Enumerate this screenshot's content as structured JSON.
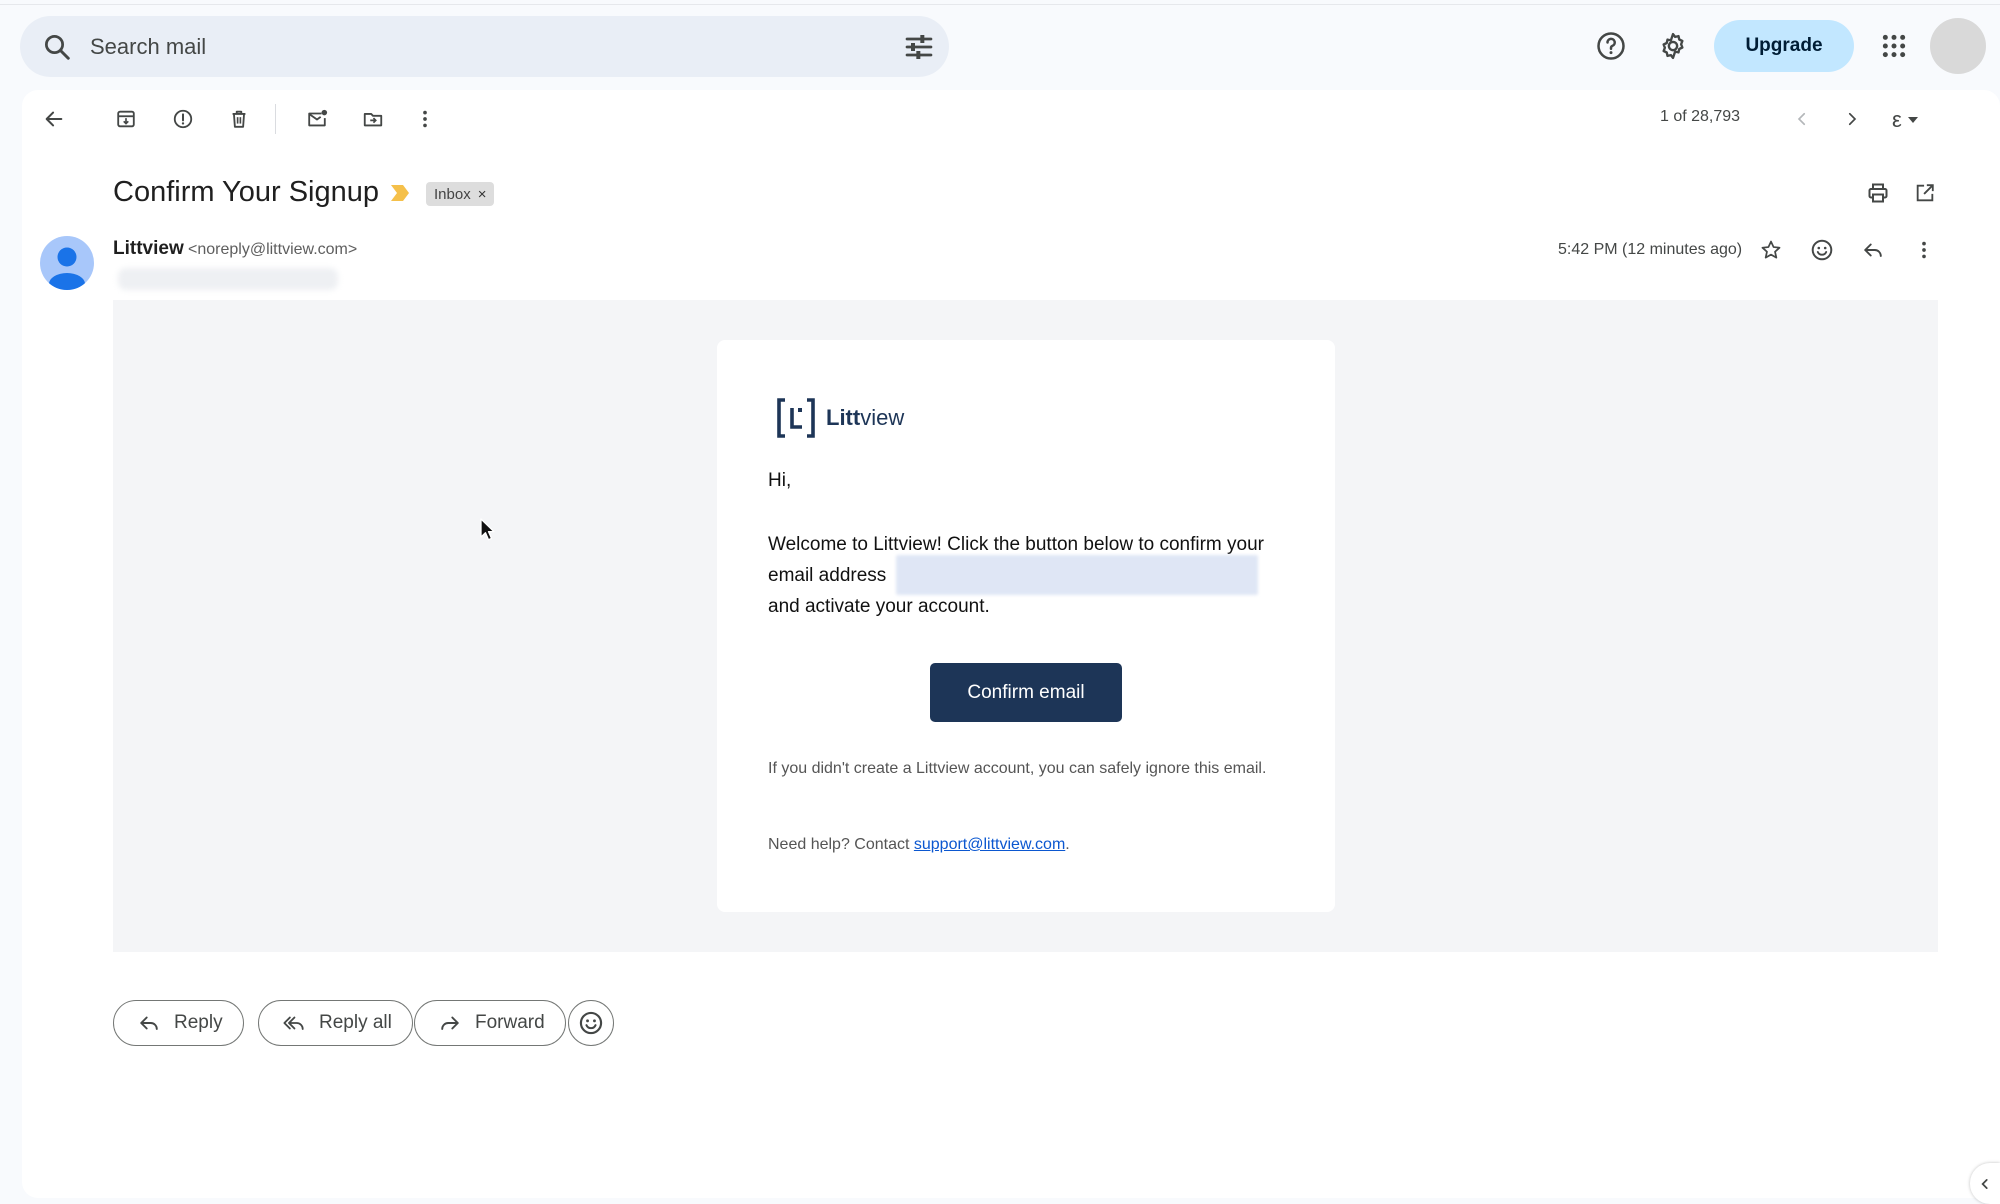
{
  "search": {
    "placeholder": "Search mail"
  },
  "header": {
    "upgrade_label": "Upgrade"
  },
  "toolbar": {
    "pager_text": "1 of 28,793",
    "lang_glyph": "ε"
  },
  "message": {
    "subject": "Confirm Your Signup",
    "label": "Inbox",
    "label_remove": "×",
    "sender_name": "Littview",
    "sender_email": "<noreply@littview.com>",
    "timestamp": "5:42 PM (12 minutes ago)"
  },
  "email_body": {
    "brand_bold": "Litt",
    "brand_rest": "view",
    "greeting": "Hi,",
    "welcome_text": "Welcome to Littview! Click the button below to confirm your email address",
    "welcome_text_end": "and activate your account.",
    "confirm_label": "Confirm email",
    "ignore_text": "If you didn't create a Littview account, you can safely ignore this email.",
    "help_prefix": "Need help? Contact ",
    "help_link": "support@littview.com",
    "help_suffix": ".",
    "brand_color": "#1d3557"
  },
  "actions": {
    "reply_label": "Reply",
    "reply_all_label": "Reply all",
    "forward_label": "Forward"
  },
  "colors": {
    "accent_upgrade": "#c2e7ff",
    "link": "#0b57d0",
    "important_marker": "#f5c04a"
  }
}
